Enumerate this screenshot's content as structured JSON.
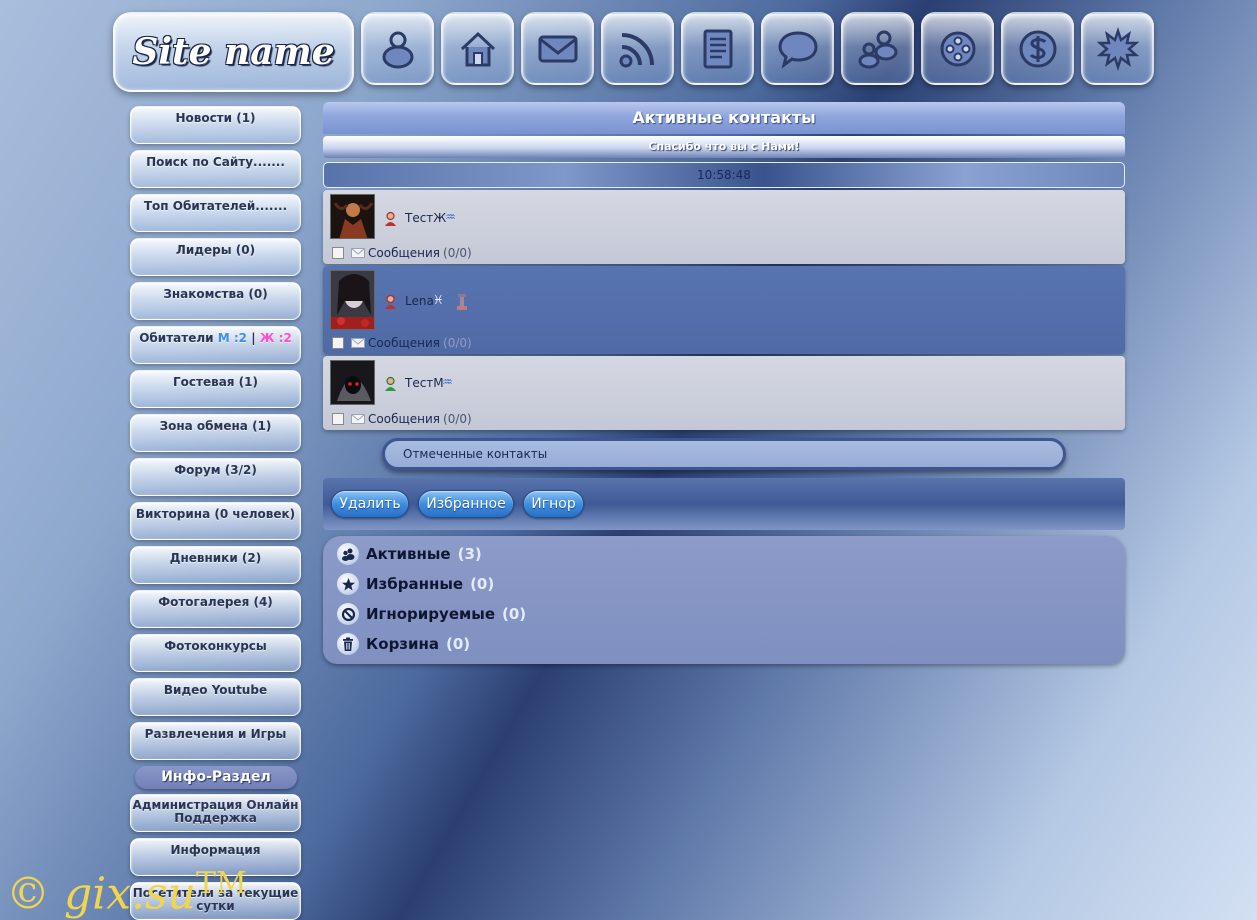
{
  "site": {
    "name": "Site name"
  },
  "topnav": [
    {
      "icon": "user-icon"
    },
    {
      "icon": "home-icon"
    },
    {
      "icon": "mail-icon"
    },
    {
      "icon": "rss-icon"
    },
    {
      "icon": "document-icon"
    },
    {
      "icon": "chat-icon"
    },
    {
      "icon": "users-icon"
    },
    {
      "icon": "film-reel-icon"
    },
    {
      "icon": "dollar-icon"
    },
    {
      "icon": "starburst-icon"
    }
  ],
  "sidebar": {
    "items": [
      {
        "label": "Новости (1)"
      },
      {
        "label": "Поиск по Сайту......."
      },
      {
        "label": "Топ Обитателей......."
      },
      {
        "label": "Лидеры (0)"
      },
      {
        "label": "Знакомства (0)"
      },
      {
        "label": "Гостевая (1)"
      },
      {
        "label": "Зона обмена (1)"
      },
      {
        "label": "Форум (3/2)"
      },
      {
        "label": "Викторина (0 человек)"
      },
      {
        "label": "Дневники (2)"
      },
      {
        "label": "Фотогалерея (4)"
      },
      {
        "label": "Фотоконкурсы"
      },
      {
        "label": "Видео Youtube"
      },
      {
        "label": "Развлечения и Игры"
      }
    ],
    "residents": {
      "label": "Обитатели",
      "male": "М :2",
      "sep": "|",
      "female": "Ж :2"
    },
    "info_header": "Инфо-Раздел",
    "info_items": [
      {
        "label": "Администрация Онлайн Поддержка"
      },
      {
        "label": "Информация"
      },
      {
        "label": "Посетители за текущие сутки"
      }
    ]
  },
  "main": {
    "title": "Активные контакты",
    "thanks": "Спасибо что вы с Нами!",
    "time": "10:58:48",
    "contacts": [
      {
        "name": "ТестЖ",
        "gender": "female",
        "zodiac": "♒",
        "messages_label": "Сообщения",
        "messages_count": "(0/0)"
      },
      {
        "name": "Lena",
        "gender": "female",
        "zodiac": "♓",
        "messages_label": "Сообщения",
        "messages_count": "(0/0)"
      },
      {
        "name": "ТестМ",
        "gender": "male",
        "zodiac": "♒",
        "messages_label": "Сообщения",
        "messages_count": "(0/0)"
      }
    ],
    "marked_contacts": "Отмеченные контакты",
    "buttons": {
      "delete": "Удалить",
      "favorite": "Избранное",
      "ignore": "Игнор"
    },
    "folders": [
      {
        "label": "Активные",
        "count": "(3)",
        "icon": "users-icon"
      },
      {
        "label": "Избранные",
        "count": "(0)",
        "icon": "star-icon"
      },
      {
        "label": "Игнорируемые",
        "count": "(0)",
        "icon": "block-icon"
      },
      {
        "label": "Корзина",
        "count": "(0)",
        "icon": "trash-icon"
      }
    ]
  },
  "footer": {
    "copyright": "© gix.su",
    "tm": "TM"
  },
  "colors": {
    "male": "#3f8ff0",
    "female": "#ff4fd0",
    "accent_button": "#3f8ee0"
  }
}
